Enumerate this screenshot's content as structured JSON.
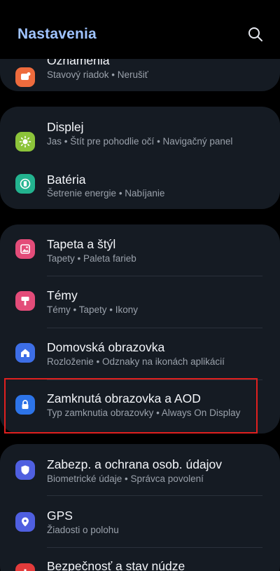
{
  "header": {
    "title": "Nastavenia",
    "search_icon": "search-icon"
  },
  "cards": [
    {
      "items": [
        {
          "title": "Oznámenia",
          "subtitle": "Stavový riadok  •  Nerušiť",
          "icon": "notification-icon",
          "color": "#ee6b3d"
        }
      ]
    },
    {
      "items": [
        {
          "title": "Displej",
          "subtitle": "Jas  •  Štít pre pohodlie očí  •  Navigačný panel",
          "icon": "brightness-icon",
          "color": "#8cc43a"
        },
        {
          "title": "Batéria",
          "subtitle": "Šetrenie energie  •  Nabíjanie",
          "icon": "battery-icon",
          "color": "#23b38f"
        }
      ]
    },
    {
      "items": [
        {
          "title": "Tapeta a štýl",
          "subtitle": "Tapety  •  Paleta farieb",
          "icon": "wallpaper-icon",
          "color": "#e34c79"
        },
        {
          "title": "Témy",
          "subtitle": "Témy  •  Tapety  •  Ikony",
          "icon": "theme-brush-icon",
          "color": "#e34c79"
        },
        {
          "title": "Domovská obrazovka",
          "subtitle": "Rozloženie  •  Odznaky na ikonách aplikácií",
          "icon": "home-icon",
          "color": "#3d6ee6"
        },
        {
          "title": "Zamknutá obrazovka a AOD",
          "subtitle": "Typ zamknutia obrazovky  •  Always On Display",
          "icon": "lock-icon",
          "color": "#2d74e8"
        }
      ]
    },
    {
      "items": [
        {
          "title": "Zabezp. a ochrana osob. údajov",
          "subtitle": "Biometrické údaje  •  Správca povolení",
          "icon": "shield-icon",
          "color": "#4f5fe0"
        },
        {
          "title": "GPS",
          "subtitle": "Žiadosti o polohu",
          "icon": "location-icon",
          "color": "#4f5fe0"
        },
        {
          "title": "Bezpečnosť a stav núdze",
          "subtitle": "",
          "icon": "emergency-icon",
          "color": "#e33b3b"
        }
      ]
    }
  ],
  "highlight_color": "#e0201f"
}
